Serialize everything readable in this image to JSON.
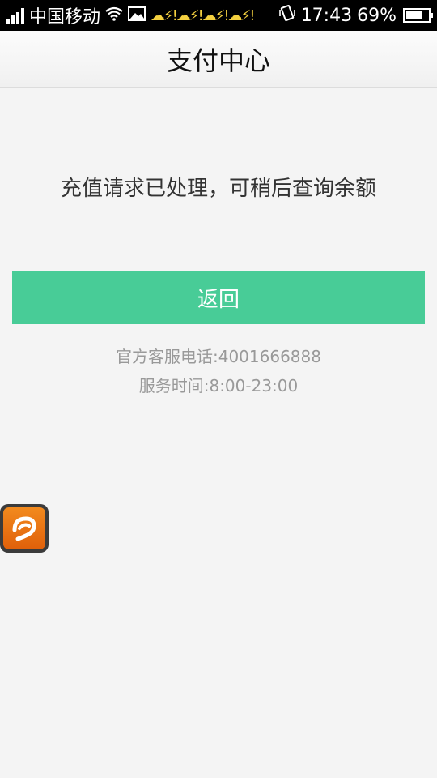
{
  "status_bar": {
    "carrier": "中国移动",
    "time": "17:43",
    "battery": "69%",
    "icons": [
      "signal-icon",
      "wifi-icon",
      "image-icon",
      "weather-icon",
      "vibrate-icon",
      "battery-icon"
    ]
  },
  "header": {
    "title": "支付中心"
  },
  "main": {
    "message": "充值请求已处理，可稍后查询余额",
    "back_label": "返回",
    "phone_text": "官方客服电话:4001666888",
    "hours_text": "服务时间:8:00-23:00"
  },
  "colors": {
    "accent": "#48cc97",
    "background": "#f4f4f4",
    "floating_app": "#e86f12"
  }
}
